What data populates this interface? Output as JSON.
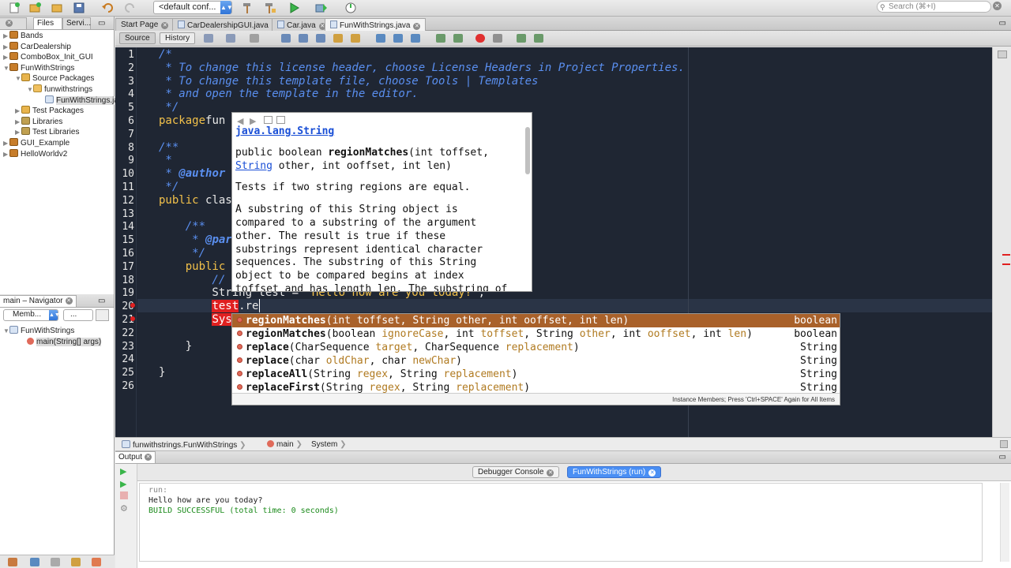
{
  "toolbar": {
    "config": "<default conf...",
    "search_placeholder": "Search (⌘+I)"
  },
  "projects_panel": {
    "tabs": [
      "Files",
      "Servi..."
    ],
    "tree": [
      {
        "label": "Bands",
        "indent": 0,
        "icon": "project-icon",
        "open": false
      },
      {
        "label": "CarDealership",
        "indent": 0,
        "icon": "project-icon",
        "open": false
      },
      {
        "label": "ComboBox_Init_GUI",
        "indent": 0,
        "icon": "project-icon",
        "open": false
      },
      {
        "label": "FunWithStrings",
        "indent": 0,
        "icon": "project-icon",
        "open": true
      },
      {
        "label": "Source Packages",
        "indent": 1,
        "icon": "source-packages-icon",
        "open": true
      },
      {
        "label": "funwithstrings",
        "indent": 2,
        "icon": "package-icon",
        "open": true
      },
      {
        "label": "FunWithStrings.java",
        "indent": 3,
        "icon": "java-file-icon",
        "open": null
      },
      {
        "label": "Test Packages",
        "indent": 1,
        "icon": "source-packages-icon",
        "open": false
      },
      {
        "label": "Libraries",
        "indent": 1,
        "icon": "library-icon",
        "open": false
      },
      {
        "label": "Test Libraries",
        "indent": 1,
        "icon": "library-icon",
        "open": false
      },
      {
        "label": "GUI_Example",
        "indent": 0,
        "icon": "project-icon",
        "open": false
      },
      {
        "label": "HelloWorldv2",
        "indent": 0,
        "icon": "project-icon",
        "open": false
      }
    ]
  },
  "navigator": {
    "title": "main – Navigator",
    "members_select": "Memb...",
    "second_select": "...",
    "tree": [
      {
        "label": "FunWithStrings"
      },
      {
        "label": "main(String[] args)"
      }
    ]
  },
  "editor_tabs": [
    "Start Page",
    "CarDealershipGUI.java",
    "Car.java",
    "FunWithStrings.java"
  ],
  "editor_toolbar": {
    "source": "Source",
    "history": "History"
  },
  "code": {
    "line_numbers": [
      "1",
      "2",
      "3",
      "4",
      "5",
      "6",
      "7",
      "8",
      "9",
      "10",
      "11",
      "12",
      "13",
      "14",
      "15",
      "16",
      "17",
      "18",
      "19",
      "20",
      "21",
      "22",
      "23",
      "24",
      "25",
      "26"
    ],
    "lines": [
      [
        [
          "cm",
          "/*"
        ]
      ],
      [
        [
          "cm",
          " * To change this license header, choose License Headers in Project Properties."
        ]
      ],
      [
        [
          "cm",
          " * To change this template file, choose Tools | Templates"
        ]
      ],
      [
        [
          "cm",
          " * and open the template in the editor."
        ]
      ],
      [
        [
          "cm",
          " */"
        ]
      ],
      [
        [
          "kw",
          "package"
        ],
        [
          "",
          "fun"
        ]
      ],
      [],
      [
        [
          "cm",
          "/**"
        ]
      ],
      [
        [
          "cm",
          " *"
        ]
      ],
      [
        [
          "cm",
          " * "
        ],
        [
          "cm-b",
          "@author"
        ]
      ],
      [
        [
          "cm",
          " */"
        ]
      ],
      [
        [
          "kw",
          "public"
        ],
        [
          "",
          " clas"
        ]
      ],
      [],
      [
        [
          "cm",
          "    /**"
        ]
      ],
      [
        [
          "cm",
          "     * "
        ],
        [
          "cm-b",
          "@par"
        ]
      ],
      [
        [
          "cm",
          "     */"
        ]
      ],
      [
        [
          "kw",
          "    public"
        ]
      ],
      [
        [
          "cm",
          "        //"
        ]
      ],
      [
        [
          "",
          "        String test = "
        ],
        [
          "str",
          "\"Hello how are you today?\""
        ],
        [
          "",
          ";"
        ]
      ],
      [
        [
          "err",
          "        test"
        ],
        [
          "",
          ".re"
        ]
      ],
      [
        [
          "err",
          "        Sys"
        ]
      ],
      [],
      [
        [
          "",
          "    }"
        ]
      ],
      [],
      [
        [
          "",
          "}"
        ]
      ],
      []
    ]
  },
  "javadoc": {
    "class_link": "java.lang.String",
    "signature_pre": "public boolean ",
    "signature_method": "regionMatches",
    "signature_args1": "(int toffset,",
    "signature_type_link": "String",
    "signature_args2": " other, int ooffset, int len)",
    "summary": "Tests if two string regions are equal.",
    "description": [
      "A substring of this String object is",
      "compared to a substring of the argument",
      "other. The result is true if these",
      "substrings represent identical character",
      "sequences. The substring of this String",
      "object to be compared begins at index",
      "toffset and has length len. The substring of"
    ]
  },
  "completion": {
    "items": [
      {
        "name": "regionMatches",
        "params": [
          [
            "",
            "(int toffset, String other, int ooffset, int len)"
          ]
        ],
        "ret": "boolean"
      },
      {
        "name": "regionMatches",
        "params": [
          [
            "",
            "(boolean "
          ],
          [
            "p",
            "ignoreCase"
          ],
          [
            "",
            ", int "
          ],
          [
            "p",
            "toffset"
          ],
          [
            "",
            ", String "
          ],
          [
            "p",
            "other"
          ],
          [
            "",
            ", int "
          ],
          [
            "p",
            "ooffset"
          ],
          [
            "",
            ", int "
          ],
          [
            "p",
            "len"
          ],
          [
            "",
            ")"
          ]
        ],
        "ret": "boolean"
      },
      {
        "name": "replace",
        "params": [
          [
            "",
            "(CharSequence "
          ],
          [
            "p",
            "target"
          ],
          [
            "",
            ", CharSequence "
          ],
          [
            "p",
            "replacement"
          ],
          [
            "",
            ")"
          ]
        ],
        "ret": "String"
      },
      {
        "name": "replace",
        "params": [
          [
            "",
            "(char "
          ],
          [
            "p",
            "oldChar"
          ],
          [
            "",
            ", char "
          ],
          [
            "p",
            "newChar"
          ],
          [
            "",
            ")"
          ]
        ],
        "ret": "String"
      },
      {
        "name": "replaceAll",
        "params": [
          [
            "",
            "(String "
          ],
          [
            "p",
            "regex"
          ],
          [
            "",
            ", String "
          ],
          [
            "p",
            "replacement"
          ],
          [
            "",
            ")"
          ]
        ],
        "ret": "String"
      },
      {
        "name": "replaceFirst",
        "params": [
          [
            "",
            "(String "
          ],
          [
            "p",
            "regex"
          ],
          [
            "",
            ", String "
          ],
          [
            "p",
            "replacement"
          ],
          [
            "",
            ")"
          ]
        ],
        "ret": "String"
      }
    ],
    "footer": "Instance Members; Press 'Ctrl+SPACE' Again for All Items"
  },
  "breadcrumb": [
    "funwithstrings.FunWithStrings",
    "main",
    "System"
  ],
  "output": {
    "panel_title": "Output",
    "tabs": [
      "Debugger Console",
      "FunWithStrings (run)"
    ],
    "lines": [
      {
        "text": "run:",
        "color": "#888888"
      },
      {
        "text": "Hello how are you today?",
        "color": "#222222"
      },
      {
        "text": "BUILD SUCCESSFUL (total time: 0 seconds)",
        "color": "#1a8a1a"
      }
    ]
  },
  "colors": {
    "editor_bg": "#1f2633",
    "comment": "#5a8ff0",
    "keyword": "#f2c14a",
    "completion_selected": "#a9612a",
    "error_highlight": "#e02020"
  }
}
